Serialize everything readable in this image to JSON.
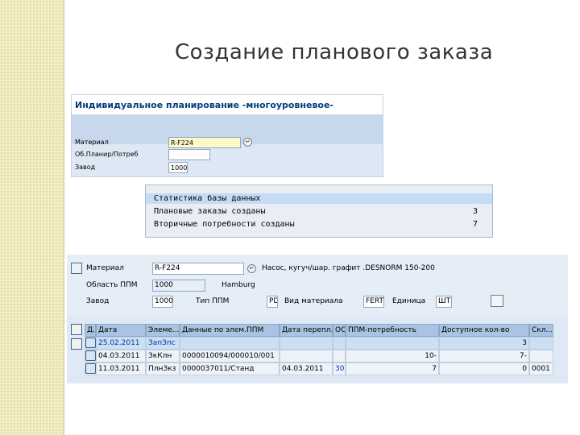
{
  "slide": {
    "title": "Создание планового заказа"
  },
  "panel1": {
    "title": "Индивидуальное планирование -многоуровневое-",
    "rows": [
      {
        "label": "Материал",
        "value": "R-F224"
      },
      {
        "label": "Об.Планир/Потреб",
        "value": ""
      },
      {
        "label": "Завод",
        "value": "1000"
      }
    ]
  },
  "stats": {
    "title": "Статистика базы данных",
    "rows": [
      {
        "label": "Плановые заказы созданы",
        "value": "3"
      },
      {
        "label": "Вторичные потребности созданы",
        "value": "7"
      }
    ]
  },
  "panel3": {
    "material_label": "Материал",
    "material_value": "R-F224",
    "material_desc": "Насос, кугуч/шар. графит .DESNORM 150-200",
    "area_label": "Область ППМ",
    "area_value": "1000",
    "area_desc": "Hamburg",
    "plant_label": "Завод",
    "plant_value": "1000",
    "mrp_type_label": "Тип ППМ",
    "mrp_type_value": "PD",
    "mat_type_label": "Вид материала",
    "mat_type_value": "FERT",
    "unit_label": "Единица",
    "unit_value": "ШТ",
    "columns": [
      "Д...",
      "Дата",
      "Элеме...",
      "Данные по элем.ППМ",
      "Дата перепл.",
      "ОС",
      "ППМ-потребность",
      "Доступное кол-во",
      "Скл..."
    ],
    "rows": [
      {
        "date": "25.02.2011",
        "elem": "ЗапЗпс",
        "data": "",
        "resched": "",
        "ex": "",
        "req": "",
        "avail": "3",
        "stor": ""
      },
      {
        "date": "04.03.2011",
        "elem": "ЗкКлн",
        "data": "0000010094/000010/001",
        "resched": "",
        "ex": "",
        "req": "10-",
        "avail": "7-",
        "stor": ""
      },
      {
        "date": "11.03.2011",
        "elem": "ПлнЗкз",
        "data": "0000037011/Станд",
        "resched": "04.03.2011",
        "ex": "30",
        "req": "7",
        "avail": "0",
        "stor": "0001"
      }
    ]
  }
}
